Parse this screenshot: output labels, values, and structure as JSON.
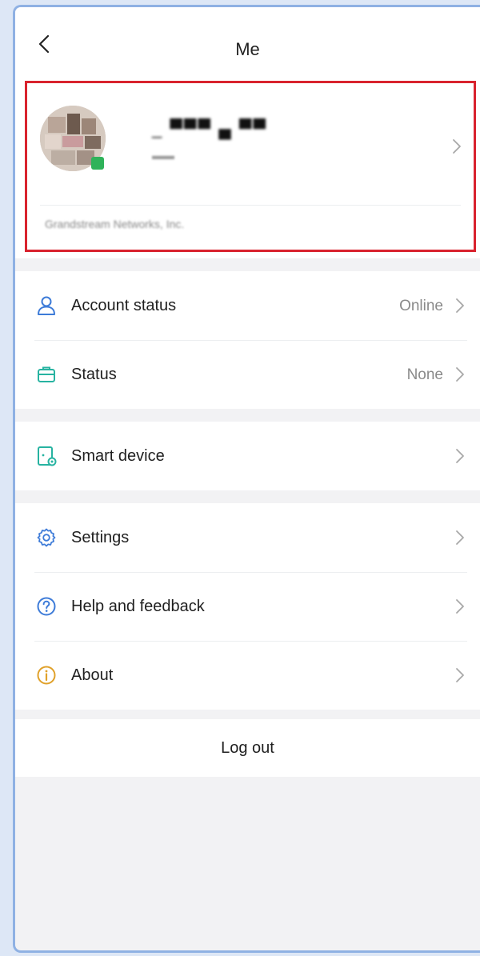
{
  "header": {
    "title": "Me",
    "back_icon": "chevron-left-icon"
  },
  "profile": {
    "name": "_ ▀▀▀ ▄ ▀▀",
    "sub": "▬▬",
    "company": "Grandstream Networks, Inc.",
    "status_color": "#2fb35a",
    "highlight_color": "#d9232e"
  },
  "menu": {
    "account_status": {
      "label": "Account status",
      "value": "Online",
      "icon": "person-icon"
    },
    "status": {
      "label": "Status",
      "value": "None",
      "icon": "briefcase-icon"
    },
    "smart_device": {
      "label": "Smart device",
      "icon": "smart-device-icon"
    },
    "settings": {
      "label": "Settings",
      "icon": "gear-icon"
    },
    "help": {
      "label": "Help and feedback",
      "icon": "question-icon"
    },
    "about": {
      "label": "About",
      "icon": "info-icon"
    }
  },
  "logout": {
    "label": "Log out"
  },
  "colors": {
    "accent_blue": "#3d7bd8",
    "teal": "#27b3a1",
    "gold": "#e0a12a"
  }
}
